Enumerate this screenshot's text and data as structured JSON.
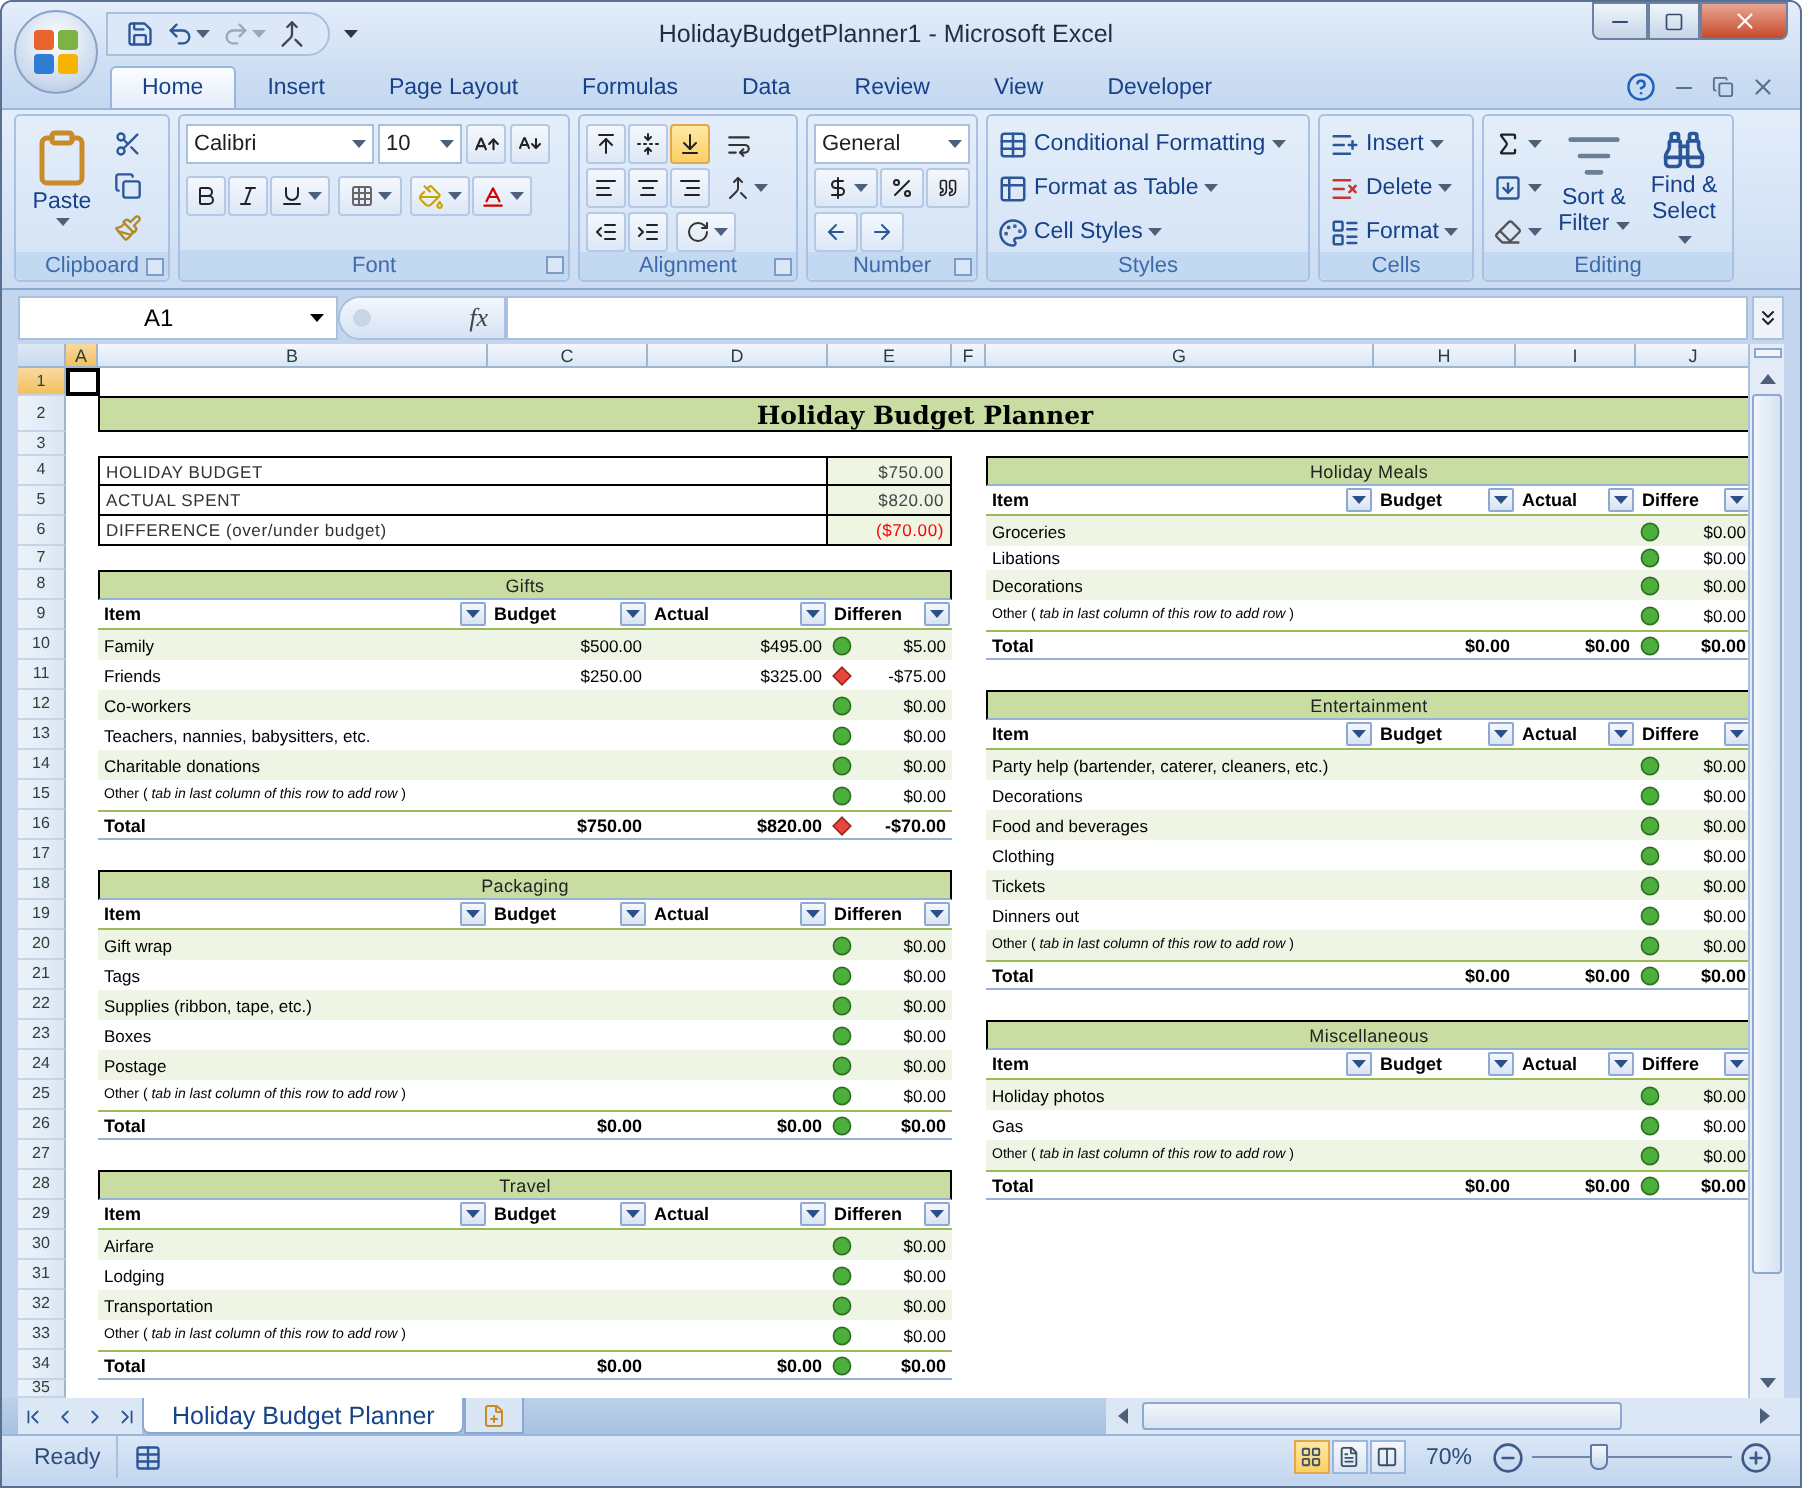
{
  "window": {
    "title": "HolidayBudgetPlanner1 - Microsoft Excel"
  },
  "ribbon_tabs": [
    {
      "label": "Home",
      "selected": true
    },
    {
      "label": "Insert",
      "selected": false
    },
    {
      "label": "Page Layout",
      "selected": false
    },
    {
      "label": "Formulas",
      "selected": false
    },
    {
      "label": "Data",
      "selected": false
    },
    {
      "label": "Review",
      "selected": false
    },
    {
      "label": "View",
      "selected": false
    },
    {
      "label": "Developer",
      "selected": false
    }
  ],
  "ribbon": {
    "clipboard": {
      "label": "Clipboard",
      "paste": "Paste"
    },
    "font": {
      "label": "Font",
      "font_name": "Calibri",
      "font_size": "10"
    },
    "alignment": {
      "label": "Alignment",
      "vertical_align": [
        {
          "kind": "top",
          "selected": false
        },
        {
          "kind": "middle",
          "selected": false
        },
        {
          "kind": "bottom",
          "selected": true
        }
      ]
    },
    "number": {
      "label": "Number",
      "format": "General"
    },
    "styles": {
      "label": "Styles",
      "buttons": [
        {
          "kind": "conditional",
          "label": "Conditional Formatting"
        },
        {
          "kind": "table",
          "label": "Format as Table"
        },
        {
          "kind": "cell",
          "label": "Cell Styles"
        }
      ]
    },
    "cells": {
      "label": "Cells",
      "buttons": [
        {
          "kind": "insert",
          "label": "Insert"
        },
        {
          "kind": "delete",
          "label": "Delete"
        },
        {
          "kind": "format",
          "label": "Format"
        }
      ]
    },
    "editing": {
      "label": "Editing",
      "sort": "Sort & Filter",
      "find": "Find & Select"
    }
  },
  "formula_bar": {
    "name_box": "A1",
    "function_label": "fx"
  },
  "column_headers": [
    {
      "label": "A",
      "selected": true
    },
    {
      "label": "B",
      "selected": false
    },
    {
      "label": "C",
      "selected": false
    },
    {
      "label": "D",
      "selected": false
    },
    {
      "label": "E",
      "selected": false
    },
    {
      "label": "F",
      "selected": false
    },
    {
      "label": "G",
      "selected": false
    },
    {
      "label": "H",
      "selected": false
    },
    {
      "label": "I",
      "selected": false
    },
    {
      "label": "J",
      "selected": false
    }
  ],
  "row_headers": [
    {
      "label": "1",
      "selected": true
    },
    {
      "label": "2",
      "selected": false
    },
    {
      "label": "3",
      "selected": false
    },
    {
      "label": "4",
      "selected": false
    },
    {
      "label": "5",
      "selected": false
    },
    {
      "label": "6",
      "selected": false
    },
    {
      "label": "7",
      "selected": false
    },
    {
      "label": "8",
      "selected": false
    },
    {
      "label": "9",
      "selected": false
    },
    {
      "label": "10",
      "selected": false
    },
    {
      "label": "11",
      "selected": false
    },
    {
      "label": "12",
      "selected": false
    },
    {
      "label": "13",
      "selected": false
    },
    {
      "label": "14",
      "selected": false
    },
    {
      "label": "15",
      "selected": false
    },
    {
      "label": "16",
      "selected": false
    },
    {
      "label": "17",
      "selected": false
    },
    {
      "label": "18",
      "selected": false
    },
    {
      "label": "19",
      "selected": false
    },
    {
      "label": "20",
      "selected": false
    },
    {
      "label": "21",
      "selected": false
    },
    {
      "label": "22",
      "selected": false
    },
    {
      "label": "23",
      "selected": false
    },
    {
      "label": "24",
      "selected": false
    },
    {
      "label": "25",
      "selected": false
    },
    {
      "label": "26",
      "selected": false
    },
    {
      "label": "27",
      "selected": false
    },
    {
      "label": "28",
      "selected": false
    },
    {
      "label": "29",
      "selected": false
    },
    {
      "label": "30",
      "selected": false
    },
    {
      "label": "31",
      "selected": false
    },
    {
      "label": "32",
      "selected": false
    },
    {
      "label": "33",
      "selected": false
    },
    {
      "label": "34",
      "selected": false
    },
    {
      "label": "35",
      "selected": false
    }
  ],
  "sheet": {
    "title": "Holiday Budget Planner",
    "summary": [
      {
        "label": "HOLIDAY BUDGET",
        "value": "$750.00",
        "negative": false
      },
      {
        "label": "ACTUAL SPENT",
        "value": "$820.00",
        "negative": false
      },
      {
        "label": "DIFFERENCE (over/under budget)",
        "value": "($70.00)",
        "negative": true
      }
    ],
    "left_tables": [
      {
        "title": "Gifts",
        "columns": [
          "Item",
          "Budget",
          "Actual",
          "Differen"
        ],
        "rows": [
          {
            "kind": "item",
            "item": "Family",
            "budget": "$500.00",
            "actual": "$495.00",
            "over_budget": false,
            "difference": "$5.00"
          },
          {
            "kind": "item",
            "item": "Friends",
            "budget": "$250.00",
            "actual": "$325.00",
            "over_budget": true,
            "difference": "-$75.00"
          },
          {
            "kind": "item",
            "item": "Co-workers",
            "over_budget": false,
            "difference": "$0.00"
          },
          {
            "kind": "item",
            "item": "Teachers, nannies, babysitters, etc.",
            "over_budget": false,
            "difference": "$0.00"
          },
          {
            "kind": "item",
            "item": "Charitable donations",
            "over_budget": false,
            "difference": "$0.00"
          },
          {
            "kind": "note",
            "item": "Other ( *tab in last column of this row to add row* )",
            "over_budget": false,
            "difference": "$0.00"
          }
        ],
        "total": {
          "label": "Total",
          "budget": "$750.00",
          "actual": "$820.00",
          "over_budget": true,
          "difference": "-$70.00"
        }
      },
      {
        "title": "Packaging",
        "columns": [
          "Item",
          "Budget",
          "Actual",
          "Differen"
        ],
        "rows": [
          {
            "kind": "item",
            "item": "Gift wrap",
            "over_budget": false,
            "difference": "$0.00"
          },
          {
            "kind": "item",
            "item": "Tags",
            "over_budget": false,
            "difference": "$0.00"
          },
          {
            "kind": "item",
            "item": "Supplies (ribbon, tape, etc.)",
            "over_budget": false,
            "difference": "$0.00"
          },
          {
            "kind": "item",
            "item": "Boxes",
            "over_budget": false,
            "difference": "$0.00"
          },
          {
            "kind": "item",
            "item": "Postage",
            "over_budget": false,
            "difference": "$0.00"
          },
          {
            "kind": "note",
            "item": "Other ( *tab in last column of this row to add row* )",
            "over_budget": false,
            "difference": "$0.00"
          }
        ],
        "total": {
          "label": "Total",
          "budget": "$0.00",
          "actual": "$0.00",
          "over_budget": false,
          "difference": "$0.00"
        }
      },
      {
        "title": "Travel",
        "columns": [
          "Item",
          "Budget",
          "Actual",
          "Differen"
        ],
        "rows": [
          {
            "kind": "item",
            "item": "Airfare",
            "over_budget": false,
            "difference": "$0.00"
          },
          {
            "kind": "item",
            "item": "Lodging",
            "over_budget": false,
            "difference": "$0.00"
          },
          {
            "kind": "item",
            "item": "Transportation",
            "over_budget": false,
            "difference": "$0.00"
          },
          {
            "kind": "note",
            "item": "Other ( *tab in last column of this row to add row* )",
            "over_budget": false,
            "difference": "$0.00"
          }
        ],
        "total": {
          "label": "Total",
          "budget": "$0.00",
          "actual": "$0.00",
          "over_budget": false,
          "difference": "$0.00"
        }
      }
    ],
    "right_tables": [
      {
        "title": "Holiday Meals",
        "columns": [
          "Item",
          "Budget",
          "Actual",
          "Differe"
        ],
        "rows": [
          {
            "kind": "item",
            "item": "Groceries",
            "over_budget": false,
            "difference": "$0.00"
          },
          {
            "kind": "item",
            "item": "Libations",
            "over_budget": false,
            "difference": "$0.00"
          },
          {
            "kind": "item",
            "item": "Decorations",
            "over_budget": false,
            "difference": "$0.00"
          },
          {
            "kind": "note",
            "item": "Other ( *tab in last column of this row to add row* )",
            "over_budget": false,
            "difference": "$0.00"
          }
        ],
        "total": {
          "label": "Total",
          "budget": "$0.00",
          "actual": "$0.00",
          "over_budget": false,
          "difference": "$0.00"
        }
      },
      {
        "title": "Entertainment",
        "columns": [
          "Item",
          "Budget",
          "Actual",
          "Differe"
        ],
        "rows": [
          {
            "kind": "item",
            "item": "Party help (bartender, caterer, cleaners, etc.)",
            "over_budget": false,
            "difference": "$0.00"
          },
          {
            "kind": "item",
            "item": "Decorations",
            "over_budget": false,
            "difference": "$0.00"
          },
          {
            "kind": "item",
            "item": "Food and beverages",
            "over_budget": false,
            "difference": "$0.00"
          },
          {
            "kind": "item",
            "item": "Clothing",
            "over_budget": false,
            "difference": "$0.00"
          },
          {
            "kind": "item",
            "item": "Tickets",
            "over_budget": false,
            "difference": "$0.00"
          },
          {
            "kind": "item",
            "item": "Dinners out",
            "over_budget": false,
            "difference": "$0.00"
          },
          {
            "kind": "note",
            "item": "Other ( *tab in last column of this row to add row* )",
            "over_budget": false,
            "difference": "$0.00"
          }
        ],
        "total": {
          "label": "Total",
          "budget": "$0.00",
          "actual": "$0.00",
          "over_budget": false,
          "difference": "$0.00"
        }
      },
      {
        "title": "Miscellaneous",
        "columns": [
          "Item",
          "Budget",
          "Actual",
          "Differe"
        ],
        "rows": [
          {
            "kind": "item",
            "item": "Holiday photos",
            "over_budget": false,
            "difference": "$0.00"
          },
          {
            "kind": "item",
            "item": "Gas",
            "over_budget": false,
            "difference": "$0.00"
          },
          {
            "kind": "note",
            "item": "Other ( *tab in last column of this row to add row* )",
            "over_budget": false,
            "difference": "$0.00"
          }
        ],
        "total": {
          "label": "Total",
          "budget": "$0.00",
          "actual": "$0.00",
          "over_budget": false,
          "difference": "$0.00"
        }
      }
    ]
  },
  "sheet_tabs": [
    {
      "label": "Holiday Budget Planner",
      "selected": true
    }
  ],
  "status_bar": {
    "status": "Ready",
    "views": [
      {
        "kind": "normal",
        "selected": true
      },
      {
        "kind": "page_layout",
        "selected": false
      },
      {
        "kind": "page_break",
        "selected": false
      }
    ],
    "zoom": "70%",
    "zoom_slider": {
      "level": 0.33
    }
  }
}
